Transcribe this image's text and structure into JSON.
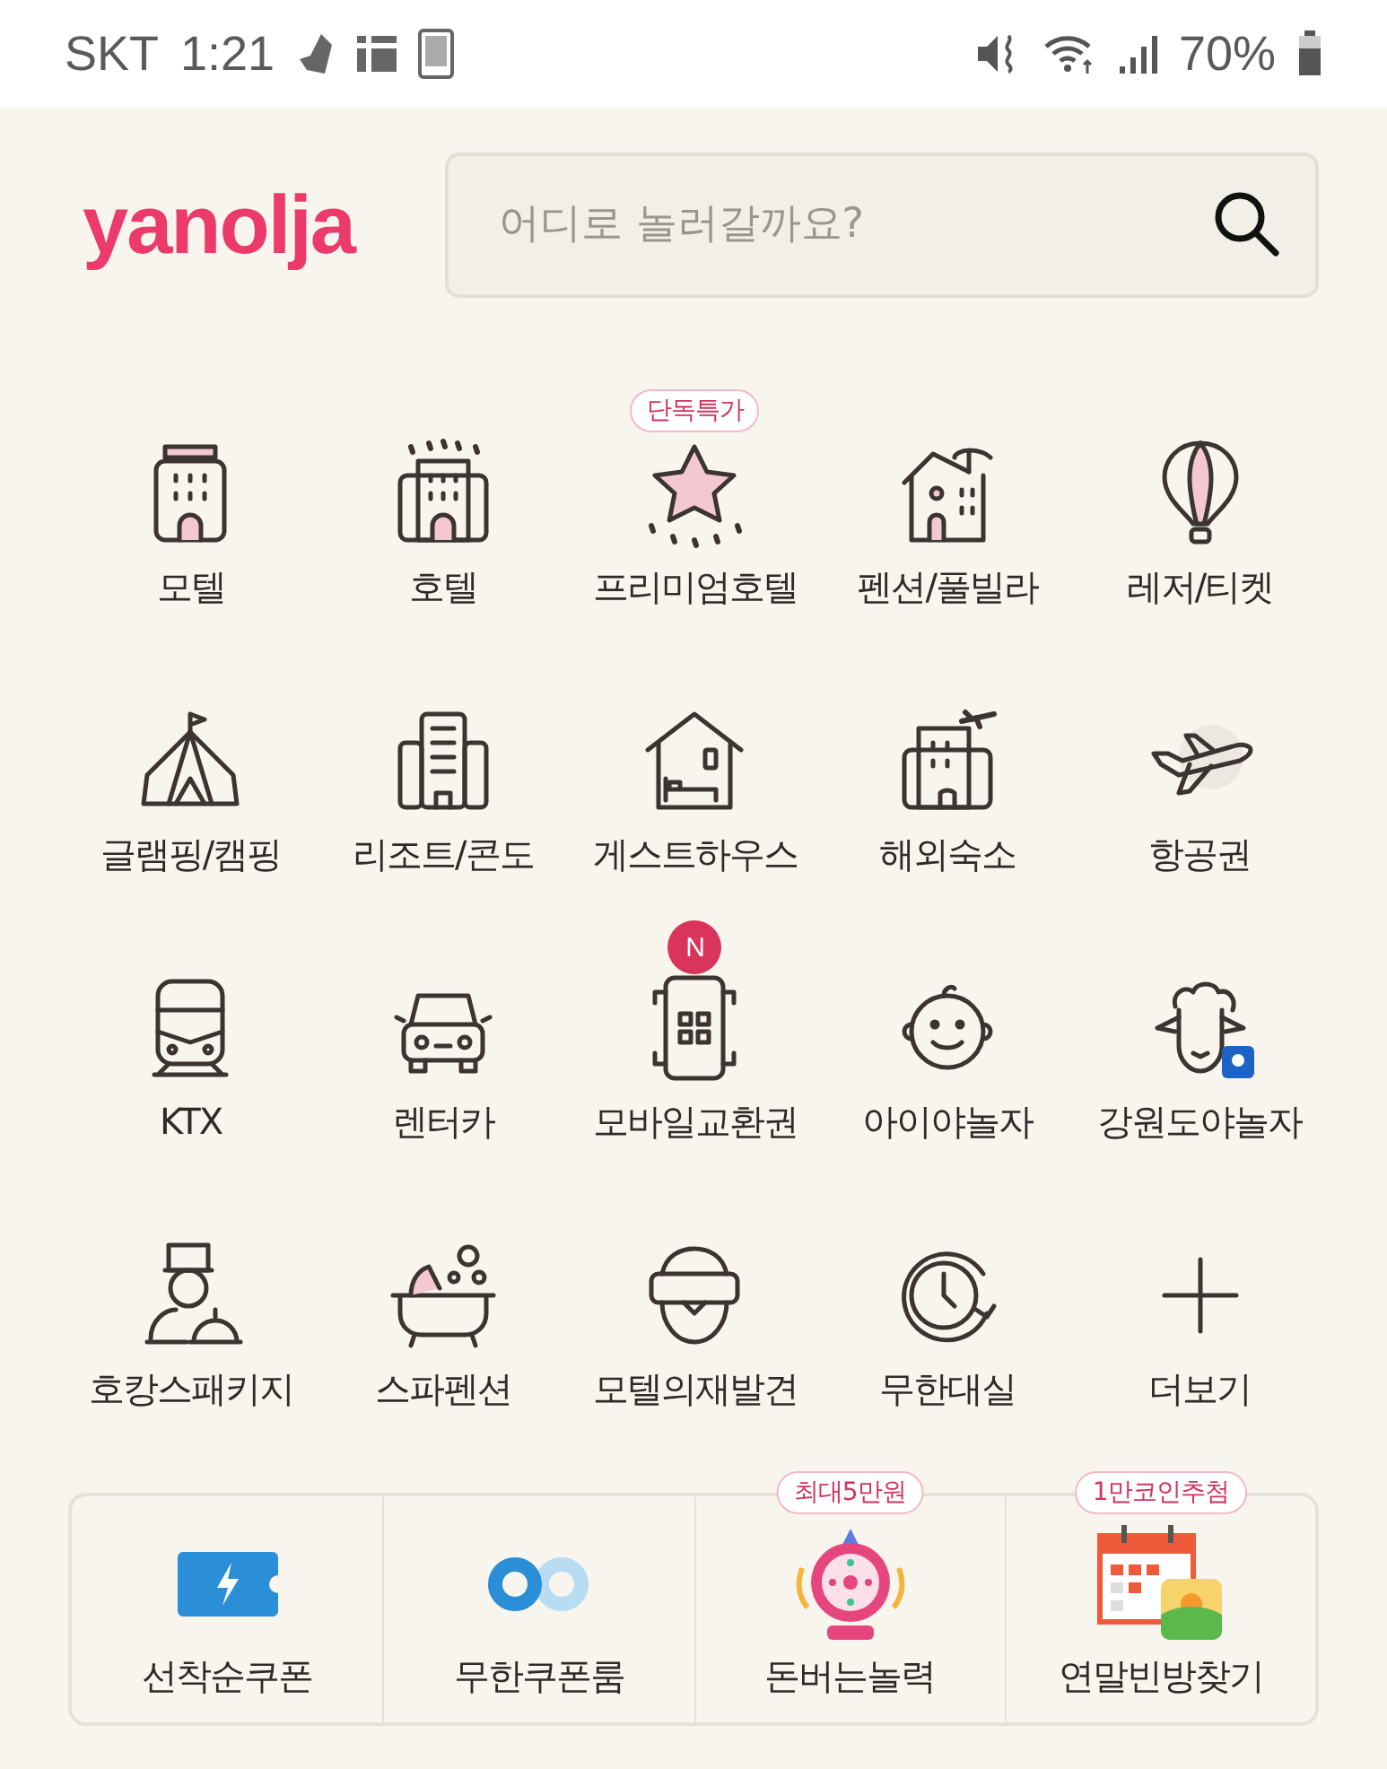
{
  "status_bar": {
    "carrier": "SKT",
    "time": "1:21",
    "battery": "70%"
  },
  "header": {
    "logo": "yanolja",
    "search": {
      "placeholder": "어디로 놀러갈까요?"
    }
  },
  "categories": [
    {
      "label": "모텔"
    },
    {
      "label": "호텔"
    },
    {
      "label": "프리미엄호텔",
      "badge": "단독특가",
      "kind": "pill"
    },
    {
      "label": "펜션/풀빌라"
    },
    {
      "label": "레저/티켓"
    },
    {
      "label": "글램핑/캠핑"
    },
    {
      "label": "리조트/콘도"
    },
    {
      "label": "게스트하우스"
    },
    {
      "label": "해외숙소"
    },
    {
      "label": "항공권"
    },
    {
      "label": "KTX"
    },
    {
      "label": "렌터카"
    },
    {
      "label": "모바일교환권",
      "badge": "N",
      "kind": "dot"
    },
    {
      "label": "아이야놀자"
    },
    {
      "label": "강원도야놀자"
    },
    {
      "label": "호캉스패키지"
    },
    {
      "label": "스파펜션"
    },
    {
      "label": "모텔의재발견"
    },
    {
      "label": "무한대실"
    },
    {
      "label": "더보기"
    }
  ],
  "promos": [
    {
      "label": "선착순쿠폰"
    },
    {
      "label": "무한쿠폰룸"
    },
    {
      "label": "돈버는놀력",
      "badge": "최대5만원"
    },
    {
      "label": "연말빈방찾기",
      "badge": "1만코인추첨"
    }
  ]
}
